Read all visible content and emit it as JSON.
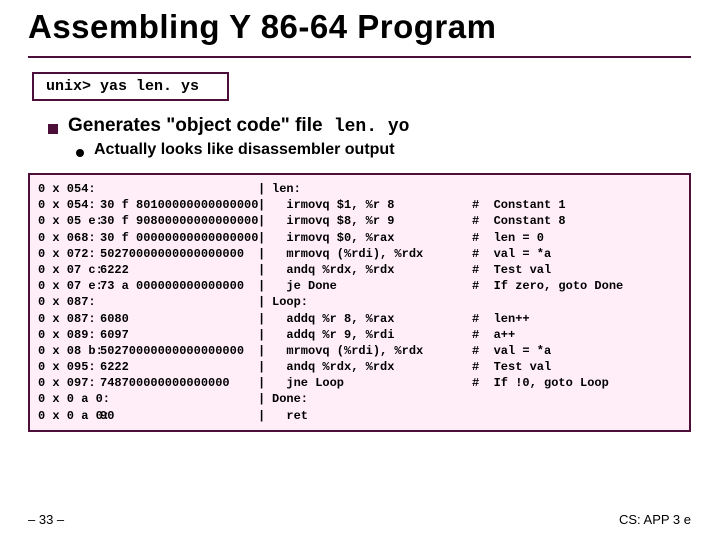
{
  "title": "Assembling Y 86-64 Program",
  "command": "unix> yas len. ys",
  "bullet1_pre": "Generates \"object code\" file ",
  "bullet1_mono": "len. yo",
  "bullet2": "Actually looks like disassembler output",
  "code_rows": [
    {
      "addr": "0 x 054:",
      "bytes": "",
      "asm": "len:",
      "cm": ""
    },
    {
      "addr": "0 x 054:",
      "bytes": "30 f 80100000000000000",
      "asm": "  irmovq $1, %r 8",
      "cm": "#  Constant 1"
    },
    {
      "addr": "0 x 05 e:",
      "bytes": "30 f 90800000000000000",
      "asm": "  irmovq $8, %r 9",
      "cm": "#  Constant 8"
    },
    {
      "addr": "0 x 068:",
      "bytes": "30 f 00000000000000000",
      "asm": "  irmovq $0, %rax",
      "cm": "#  len = 0"
    },
    {
      "addr": "0 x 072:",
      "bytes": "50270000000000000000",
      "asm": "  mrmovq (%rdi), %rdx",
      "cm": "#  val = *a"
    },
    {
      "addr": "0 x 07 c:",
      "bytes": "6222",
      "asm": "  andq %rdx, %rdx",
      "cm": "#  Test val"
    },
    {
      "addr": "0 x 07 e:",
      "bytes": "73 a 000000000000000",
      "asm": "  je Done",
      "cm": "#  If zero, goto Done"
    },
    {
      "addr": "0 x 087:",
      "bytes": "",
      "asm": "Loop:",
      "cm": ""
    },
    {
      "addr": "0 x 087:",
      "bytes": "6080",
      "asm": "  addq %r 8, %rax",
      "cm": "#  len++"
    },
    {
      "addr": "0 x 089:",
      "bytes": "6097",
      "asm": "  addq %r 9, %rdi",
      "cm": "#  a++"
    },
    {
      "addr": "0 x 08 b:",
      "bytes": "50270000000000000000",
      "asm": "  mrmovq (%rdi), %rdx",
      "cm": "#  val = *a"
    },
    {
      "addr": "0 x 095:",
      "bytes": "6222",
      "asm": "  andq %rdx, %rdx",
      "cm": "#  Test val"
    },
    {
      "addr": "0 x 097:",
      "bytes": "748700000000000000",
      "asm": "  jne Loop",
      "cm": "#  If !0, goto Loop"
    },
    {
      "addr": "0 x 0 a 0:",
      "bytes": "",
      "asm": "Done:",
      "cm": ""
    },
    {
      "addr": "0 x 0 a 0:",
      "bytes": "90",
      "asm": "  ret",
      "cm": ""
    }
  ],
  "footer_left": "– 33 –",
  "footer_right": "CS: APP 3 e"
}
